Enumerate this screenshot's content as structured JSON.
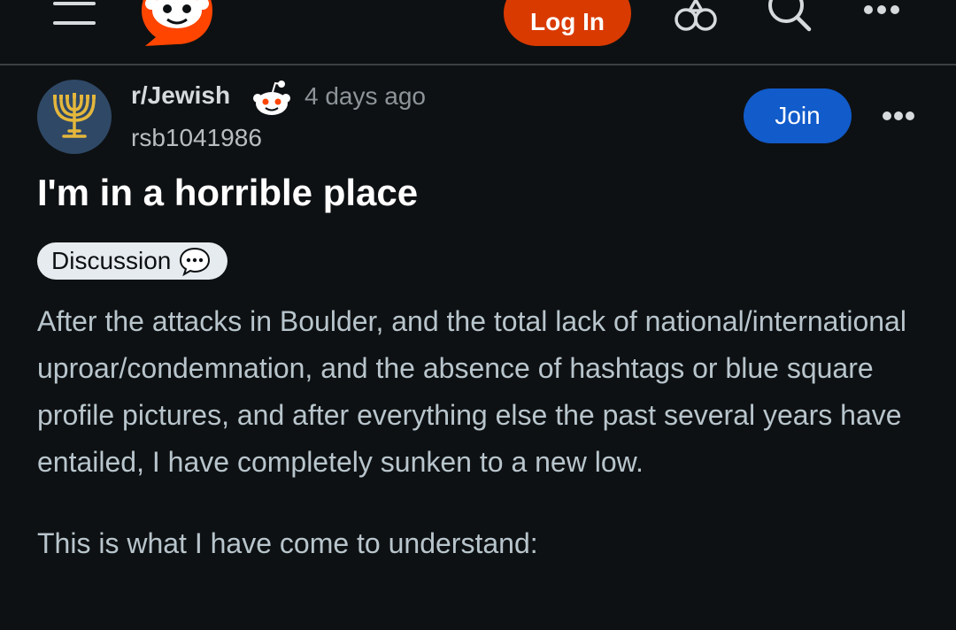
{
  "header": {
    "login_label": "Log In",
    "icons": [
      "menu-icon",
      "reddit-logo",
      "advertise-icon",
      "search-icon",
      "more-icon"
    ]
  },
  "post": {
    "subreddit": "r/Jewish",
    "time_ago": "4 days ago",
    "author": "rsb1041986",
    "join_label": "Join",
    "title": "I'm in a horrible place",
    "flair": "Discussion",
    "paragraphs": [
      "After the attacks in Boulder, and the total lack of national/international uproar/condemnation, and the absence of hashtags or blue square profile pictures, and after everything else the past several years have entailed, I have completely sunken to a new low.",
      "This is what I have come to understand:"
    ]
  },
  "colors": {
    "background": "#0e1113",
    "login_button": "#d93a00",
    "join_button": "#115bca",
    "brand_orange": "#ff4500",
    "avatar_bg": "#2f4866",
    "menorah_gold": "#e4b73c"
  }
}
